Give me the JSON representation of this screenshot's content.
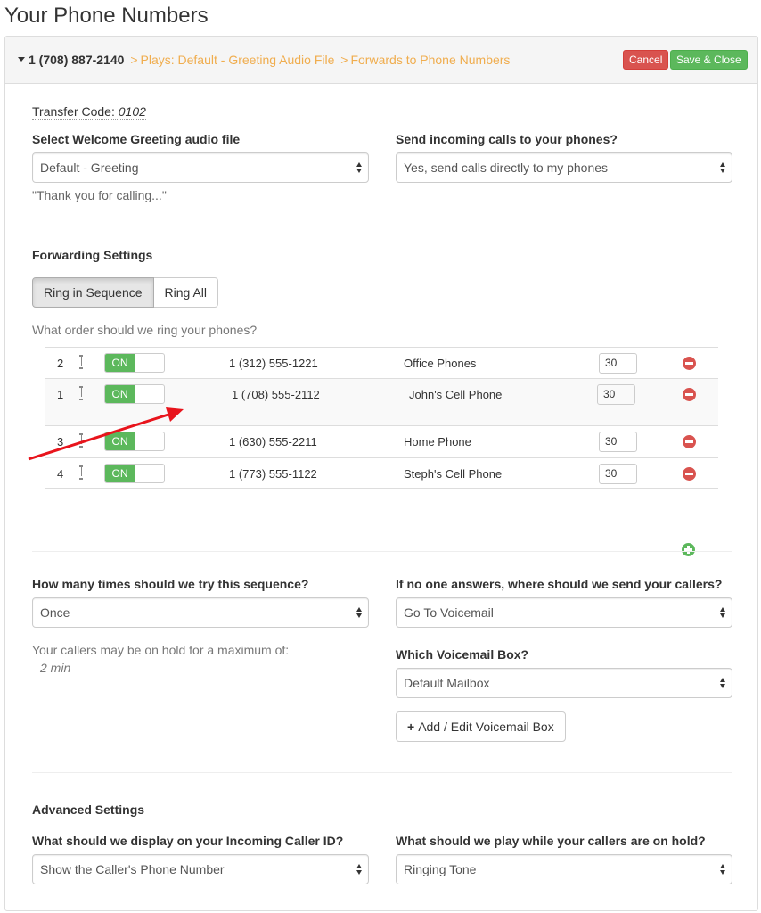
{
  "page_title": "Your Phone Numbers",
  "header": {
    "number": "1 (708) 887-2140",
    "sep": ">",
    "plays": "Plays: Default - Greeting Audio File",
    "forwards": "Forwards to Phone Numbers",
    "cancel_label": "Cancel",
    "save_label": "Save & Close"
  },
  "transfer": {
    "label": "Transfer Code:",
    "value": "0102"
  },
  "greeting": {
    "label": "Select Welcome Greeting audio file",
    "value": "Default - Greeting",
    "preview": "\"Thank you for calling...\""
  },
  "incoming": {
    "label": "Send incoming calls to your phones?",
    "value": "Yes, send calls directly to my phones"
  },
  "forwarding": {
    "heading": "Forwarding Settings",
    "mode_sequence": "Ring in Sequence",
    "mode_all": "Ring All",
    "order_question": "What order should we ring your phones?",
    "toggle_on": "ON",
    "rows": [
      {
        "order": "2",
        "number": "1 (312) 555-1221",
        "name": "Office Phones",
        "seconds": "30"
      },
      {
        "order": "1",
        "number": "1 (708) 555-2112",
        "name": "John's Cell Phone",
        "seconds": "30"
      },
      {
        "order": "3",
        "number": "1 (630) 555-2211",
        "name": "Home Phone",
        "seconds": "30"
      },
      {
        "order": "4",
        "number": "1 (773) 555-1122",
        "name": "Steph's Cell Phone",
        "seconds": "30"
      }
    ]
  },
  "sequence": {
    "label": "How many times should we try this sequence?",
    "value": "Once",
    "hold_note": "Your callers may be on hold for a maximum of:",
    "hold_value": "2 min"
  },
  "no_answer": {
    "label": "If no one answers, where should we send your callers?",
    "value": "Go To Voicemail",
    "vm_label": "Which Voicemail Box?",
    "vm_value": "Default Mailbox",
    "vm_button": "Add / Edit Voicemail Box"
  },
  "advanced": {
    "heading": "Advanced Settings",
    "callerid_label": "What should we display on your Incoming Caller ID?",
    "callerid_value": "Show the Caller's Phone Number",
    "hold_label": "What should we play while your callers are on hold?",
    "hold_value": "Ringing Tone"
  },
  "colors": {
    "accent_orange": "#f0ad4e",
    "danger": "#d9534f",
    "success": "#5cb85c",
    "annotation_arrow": "#e8141c"
  }
}
